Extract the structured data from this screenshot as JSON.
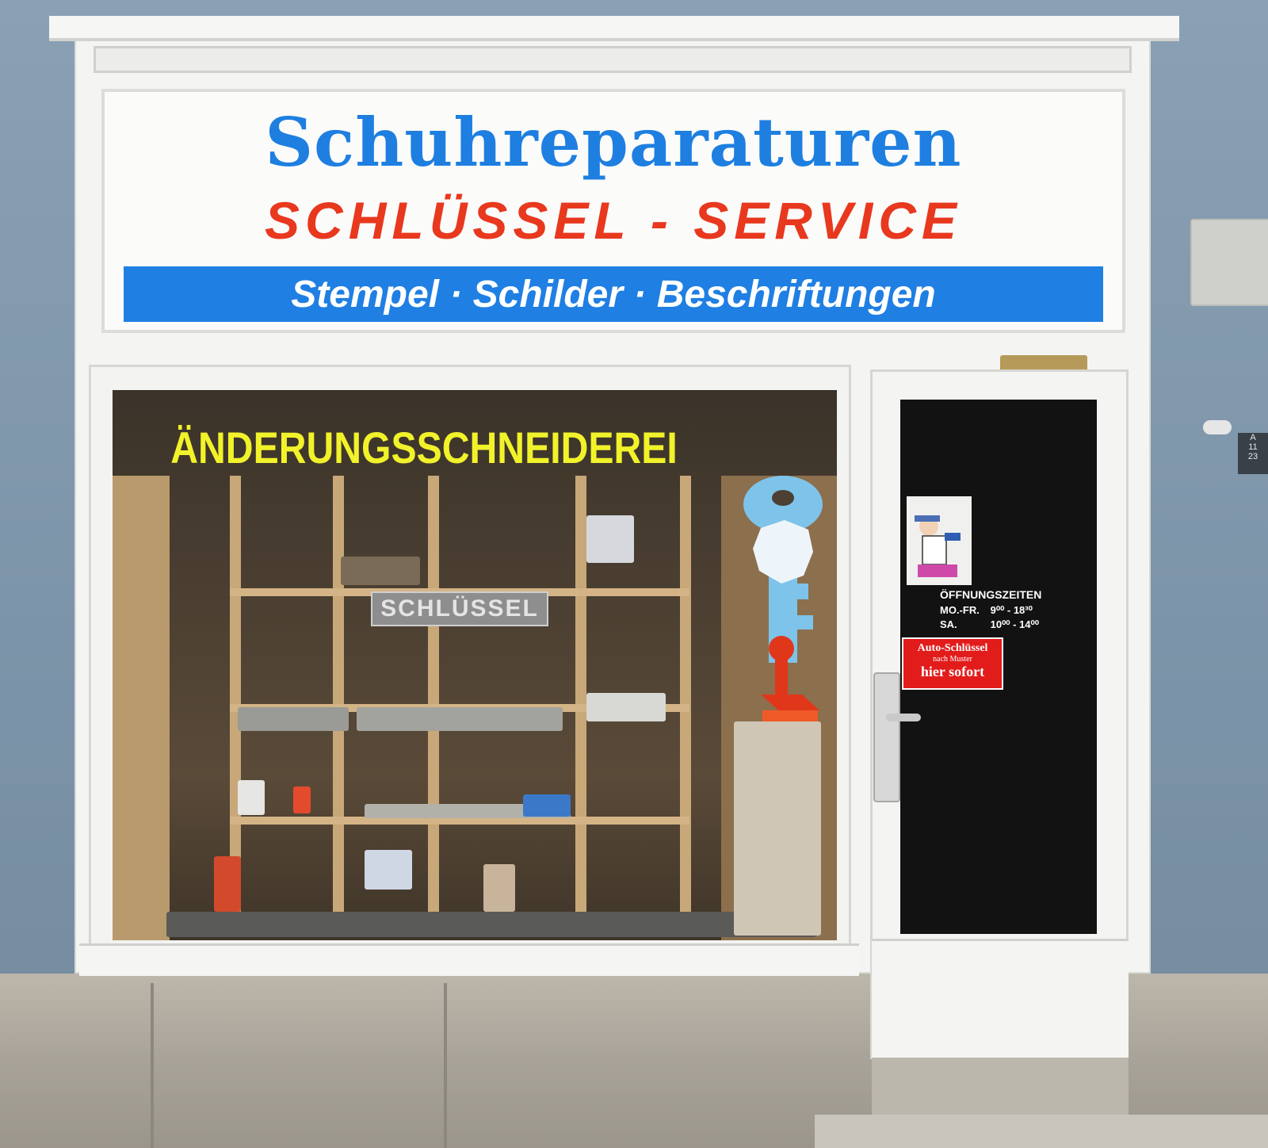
{
  "fascia": {
    "title": "Schuhreparaturen",
    "subtitle": "SCHLÜSSEL - SERVICE",
    "band": "Stempel · Schilder · Beschriftungen"
  },
  "window": {
    "lettering": "ÄNDERUNGSSCHNEIDEREI",
    "rack_sign": "SCHLÜSSEL"
  },
  "door": {
    "hours": {
      "title": "ÖFFNUNGSZEITEN",
      "rows": [
        {
          "days": "MO.-FR.",
          "time": "9⁰⁰ - 18³⁰"
        },
        {
          "days": "SA.",
          "time": "10⁰⁰ - 14⁰⁰"
        }
      ]
    },
    "car_key_sign": {
      "line1": "Auto-Schlüssel",
      "line2": "nach Muster",
      "line3": "hier sofort"
    }
  },
  "house_number": {
    "letter": "A",
    "code": "11",
    "number": "23"
  },
  "colors": {
    "title_blue": "#1e7fe0",
    "subtitle_red": "#e8381e",
    "band_blue": "#1f7fe3",
    "window_yellow": "#f1f22a",
    "wall_blue_grey": "#7f96aa",
    "car_sign_red": "#e21b1b"
  }
}
